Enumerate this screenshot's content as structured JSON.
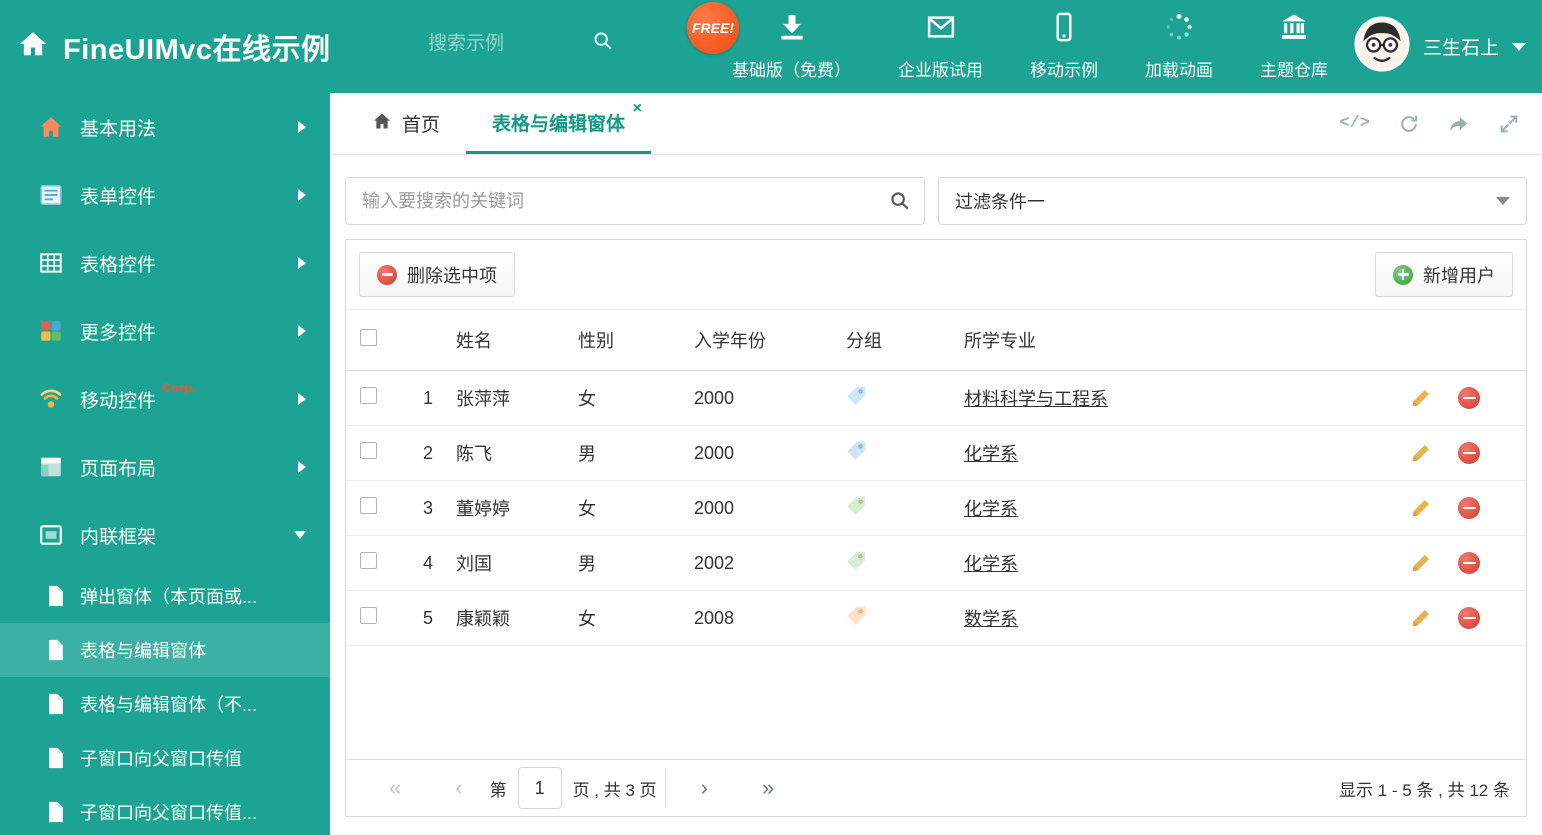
{
  "header": {
    "title": "FineUIMvc在线示例",
    "search_placeholder": "搜索示例",
    "free_badge": "FREE!",
    "nav": [
      {
        "label": "基础版（免费）",
        "icon": "download-icon"
      },
      {
        "label": "企业版试用",
        "icon": "envelope-icon"
      },
      {
        "label": "移动示例",
        "icon": "mobile-icon"
      },
      {
        "label": "加载动画",
        "icon": "spinner-icon"
      },
      {
        "label": "主题仓库",
        "icon": "bank-icon"
      }
    ],
    "user_name": "三生石上"
  },
  "sidebar": {
    "items": [
      {
        "label": "基本用法",
        "icon": "home-icon"
      },
      {
        "label": "表单控件",
        "icon": "form-icon"
      },
      {
        "label": "表格控件",
        "icon": "table-icon"
      },
      {
        "label": "更多控件",
        "icon": "widgets-icon"
      },
      {
        "label": "移动控件",
        "badge": "Corp.",
        "icon": "signal-icon"
      },
      {
        "label": "页面布局",
        "icon": "layout-icon"
      },
      {
        "label": "内联框架",
        "icon": "frame-icon"
      }
    ],
    "subitems": [
      {
        "label": "弹出窗体（本页面或..."
      },
      {
        "label": "表格与编辑窗体"
      },
      {
        "label": "表格与编辑窗体（不..."
      },
      {
        "label": "子窗口向父窗口传值"
      },
      {
        "label": "子窗口向父窗口传值..."
      }
    ]
  },
  "tabs": {
    "home": "首页",
    "active": "表格与编辑窗体"
  },
  "filter": {
    "search_placeholder": "输入要搜索的关键词",
    "dropdown_value": "过滤条件一"
  },
  "grid": {
    "delete_button": "删除选中项",
    "add_button": "新增用户",
    "columns": {
      "name": "姓名",
      "gender": "性别",
      "year": "入学年份",
      "group": "分组",
      "major": "所学专业"
    },
    "rows": [
      {
        "num": "1",
        "name": "张萍萍",
        "gender": "女",
        "year": "2000",
        "tag_color": "#58aede",
        "major": "材料科学与工程系"
      },
      {
        "num": "2",
        "name": "陈飞",
        "gender": "男",
        "year": "2000",
        "tag_color": "#58aede",
        "major": "化学系"
      },
      {
        "num": "3",
        "name": "董婷婷",
        "gender": "女",
        "year": "2000",
        "tag_color": "#82c46a",
        "major": "化学系"
      },
      {
        "num": "4",
        "name": "刘国",
        "gender": "男",
        "year": "2002",
        "tag_color": "#82c46a",
        "major": "化学系"
      },
      {
        "num": "5",
        "name": "康颖颖",
        "gender": "女",
        "year": "2008",
        "tag_color": "#f0a04e",
        "major": "数学系"
      }
    ]
  },
  "pagination": {
    "page_prefix": "第",
    "current_page": "1",
    "page_suffix": "页 , 共 3 页",
    "summary": "显示 1 - 5 条 , 共 12 条"
  },
  "colors": {
    "theme": "#1ca394",
    "danger": "#d23a2e",
    "success": "#3f9e3f",
    "free_badge": "#ee4a12",
    "pencil": "#e9b34c"
  }
}
